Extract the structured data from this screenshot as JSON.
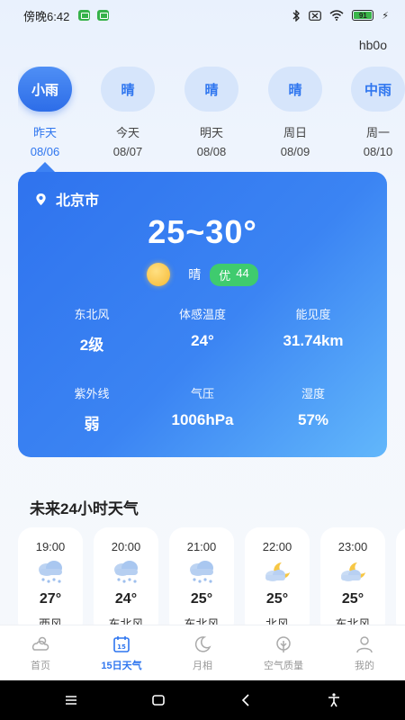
{
  "status_bar": {
    "time": "傍晚6:42",
    "battery": "91"
  },
  "user_tag": "hb0o",
  "days": [
    {
      "condition": "小雨",
      "label": "昨天",
      "date": "08/06",
      "selected": true
    },
    {
      "condition": "晴",
      "label": "今天",
      "date": "08/07",
      "selected": false
    },
    {
      "condition": "晴",
      "label": "明天",
      "date": "08/08",
      "selected": false
    },
    {
      "condition": "晴",
      "label": "周日",
      "date": "08/09",
      "selected": false
    },
    {
      "condition": "中雨",
      "label": "周一",
      "date": "08/10",
      "selected": false
    }
  ],
  "card": {
    "location": "北京市",
    "temp_range": "25~30°",
    "condition": "晴",
    "aqi_label": "优",
    "aqi_value": "44",
    "stats": [
      {
        "label": "东北风",
        "value": "2级"
      },
      {
        "label": "体感温度",
        "value": "24°"
      },
      {
        "label": "能见度",
        "value": "31.74km"
      },
      {
        "label": "紫外线",
        "value": "弱"
      },
      {
        "label": "气压",
        "value": "1006hPa"
      },
      {
        "label": "湿度",
        "value": "57%"
      }
    ]
  },
  "forecast_title": "未来24小时天气",
  "hourly": [
    {
      "time": "19:00",
      "icon": "snow-cloud-icon",
      "temp": "27°",
      "wind": "西风"
    },
    {
      "time": "20:00",
      "icon": "snow-cloud-icon",
      "temp": "24°",
      "wind": "东北风"
    },
    {
      "time": "21:00",
      "icon": "snow-cloud-icon",
      "temp": "25°",
      "wind": "东北风"
    },
    {
      "time": "22:00",
      "icon": "moon-cloud-icon",
      "temp": "25°",
      "wind": "北风"
    },
    {
      "time": "23:00",
      "icon": "moon-cloud-icon",
      "temp": "25°",
      "wind": "东北风"
    }
  ],
  "nav": [
    {
      "label": "首页",
      "icon": "home-weather-icon",
      "active": false
    },
    {
      "label": "15日天气",
      "icon": "calendar-15-icon",
      "active": true
    },
    {
      "label": "月相",
      "icon": "moon-icon",
      "active": false
    },
    {
      "label": "空气质量",
      "icon": "leaf-icon",
      "active": false
    },
    {
      "label": "我的",
      "icon": "user-icon",
      "active": false
    }
  ],
  "colors": {
    "accent": "#2f76ef",
    "aqi_good": "#3fcb6e",
    "card_start": "#2f73ee",
    "card_end": "#62b7fb"
  }
}
